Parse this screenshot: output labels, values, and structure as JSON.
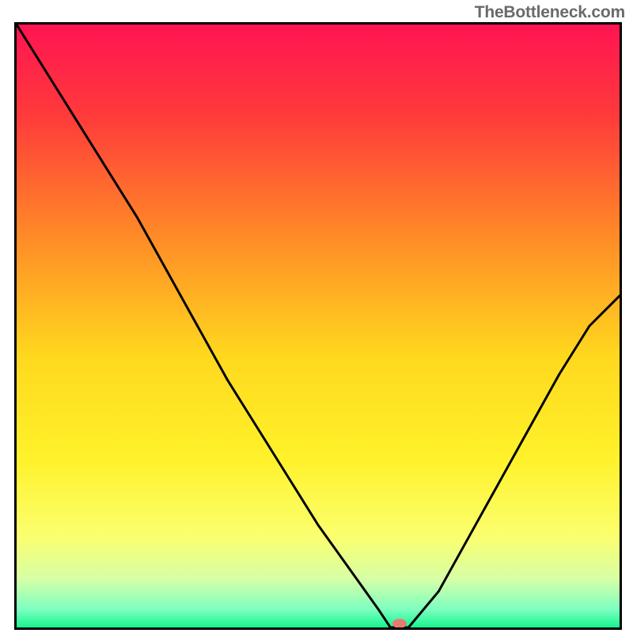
{
  "attribution": "TheBottleneck.com",
  "chart_data": {
    "type": "line",
    "title": "",
    "xlabel": "",
    "ylabel": "",
    "xlim": [
      0,
      100
    ],
    "ylim": [
      0,
      100
    ],
    "x": [
      0,
      5,
      10,
      15,
      20,
      25,
      30,
      35,
      40,
      45,
      50,
      55,
      60,
      62,
      65,
      70,
      75,
      80,
      85,
      90,
      95,
      100
    ],
    "values": [
      100,
      92,
      84,
      76,
      68,
      59,
      50,
      41,
      33,
      25,
      17,
      10,
      3,
      0,
      0,
      6,
      15,
      24,
      33,
      42,
      50,
      55
    ],
    "marker": {
      "x": 63.5,
      "y": 0
    },
    "gradient_stops": [
      {
        "pos": 0.0,
        "color": "#ff1452"
      },
      {
        "pos": 0.15,
        "color": "#ff3a3b"
      },
      {
        "pos": 0.35,
        "color": "#ff8a27"
      },
      {
        "pos": 0.55,
        "color": "#ffd81e"
      },
      {
        "pos": 0.72,
        "color": "#fff22a"
      },
      {
        "pos": 0.85,
        "color": "#fbff70"
      },
      {
        "pos": 0.92,
        "color": "#d6ffa6"
      },
      {
        "pos": 0.97,
        "color": "#7dffc0"
      },
      {
        "pos": 1.0,
        "color": "#17f58f"
      }
    ]
  }
}
